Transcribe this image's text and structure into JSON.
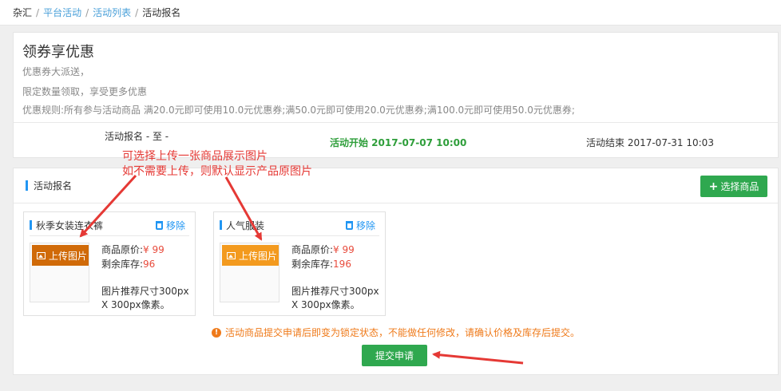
{
  "breadcrumb": {
    "items": [
      "杂汇",
      "平台活动",
      "活动列表",
      "活动报名"
    ],
    "separator": "/"
  },
  "activity": {
    "title": "领券享优惠",
    "desc1": "优惠券大派送，",
    "desc2": "限定数量领取，享受更多优惠",
    "rules": "优惠规则:所有参与活动商品 满20.0元即可使用10.0元优惠券;满50.0元即可使用20.0元优惠券;满100.0元即可使用50.0元优惠券;",
    "signup_period": "活动报名 - 至 -",
    "start": "活动开始 2017-07-07 10:00",
    "end": "活动结束 2017-07-31 10:03"
  },
  "annotation": {
    "line1": "可选择上传一张商品展示图片",
    "line2": "如不需要上传，则默认显示产品原图片"
  },
  "signup": {
    "section_title": "活动报名",
    "select_button": "选择商品",
    "products": [
      {
        "name": "秋季女装连衣裤",
        "remove_label": "移除",
        "upload_label": "上传图片",
        "price_label": "商品原价:",
        "price_value": "¥ 99",
        "stock_label": "剩余库存:",
        "stock_value": "96",
        "hint_line1": "图片推荐尺寸300px",
        "hint_line2": "X 300px像素。",
        "upload_color": "#d06a08"
      },
      {
        "name": "人气服装",
        "remove_label": "移除",
        "upload_label": "上传图片",
        "price_label": "商品原价:",
        "price_value": "¥ 99",
        "stock_label": "剩余库存:",
        "stock_value": "196",
        "hint_line1": "图片推荐尺寸300px",
        "hint_line2": "X 300px像素。",
        "upload_color": "#f39a1e"
      }
    ],
    "warning": "活动商品提交申请后即变为锁定状态，不能做任何修改，请确认价格及库存后提交。",
    "submit_button": "提交申请"
  },
  "colors": {
    "accent_blue": "#2196f3",
    "primary_green": "#2fa84f",
    "warning_orange": "#ef7a1a",
    "annotation_red": "#e53935"
  }
}
